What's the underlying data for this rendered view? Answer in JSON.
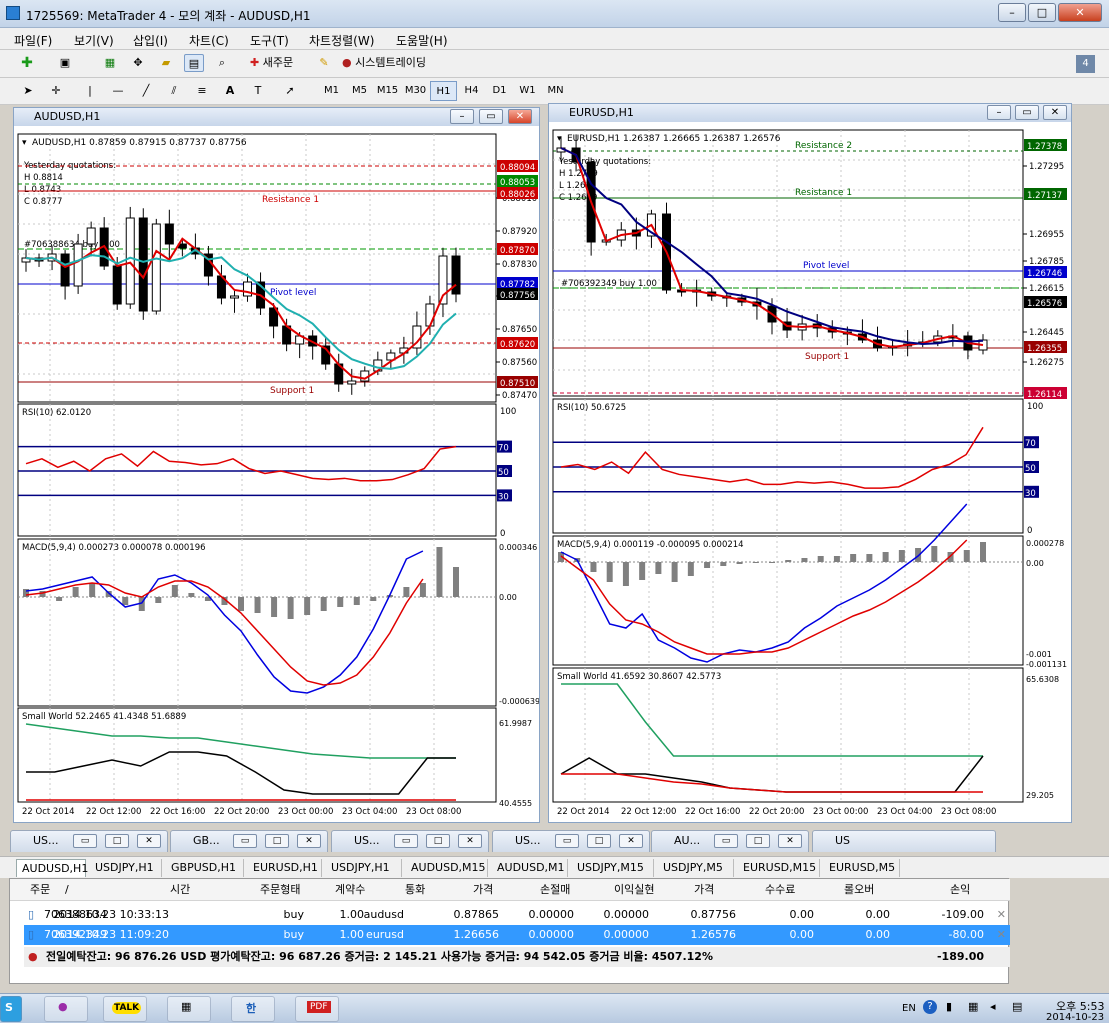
{
  "window": {
    "title": "1725569: MetaTrader 4 - 모의 계좌 - AUDUSD,H1"
  },
  "menu": [
    "파일(F)",
    "보기(V)",
    "삽입(I)",
    "차트(C)",
    "도구(T)",
    "차트정렬(W)",
    "도움말(H)"
  ],
  "toolbar": {
    "new_order": "새주문",
    "auto_trading": "시스템트레이딩",
    "badge": "4"
  },
  "drawing_tools": {
    "text_tool": "A"
  },
  "timeframes": [
    "M1",
    "M5",
    "M15",
    "M30",
    "H1",
    "H4",
    "D1",
    "W1",
    "MN"
  ],
  "active_timeframe": "H1",
  "charts": [
    {
      "window_title": "AUDUSD,H1",
      "header": "AUDUSD,H1  0.87859 0.87915 0.87737 0.87756",
      "quotations": {
        "label": "Yesterday quotations:",
        "h": "H 0.8814",
        "l": "L 0.8743",
        "c": "C 0.8777"
      },
      "order_label": "#706388634 buy 1.00",
      "levels": [
        {
          "name": "Resistance 1",
          "price": "0.88026",
          "color": "#cc0000"
        },
        {
          "name": "Pivot level",
          "price": "0.87782",
          "color": "#0000cc"
        },
        {
          "name": "Support 1",
          "price": "0.87510",
          "color": "#990000"
        }
      ],
      "price_labels": [
        {
          "text": "0.88094",
          "bg": "#cc0000"
        },
        {
          "text": "0.88053",
          "bg": "#008800"
        },
        {
          "text": "0.88026",
          "bg": "#cc0000"
        },
        {
          "text": "0.87870",
          "bg": "#cc0000"
        },
        {
          "text": "0.87782",
          "bg": "#0000cc"
        },
        {
          "text": "0.87756",
          "bg": "#000000"
        },
        {
          "text": "0.87620",
          "bg": "#cc0000"
        },
        {
          "text": "0.87510",
          "bg": "#990000"
        }
      ],
      "price_axis": [
        "0.88010",
        "0.87920",
        "0.87830",
        "0.87740",
        "0.87650",
        "0.87560",
        "0.87470"
      ],
      "rsi": {
        "label": "RSI(10) 62.0120",
        "ticks": [
          "100",
          "70",
          "50",
          "30",
          "0"
        ]
      },
      "macd": {
        "label": "MACD(5,9,4) 0.000273 0.000078 0.000196",
        "ticks": [
          "0.000346",
          "0.00",
          "-0.000639"
        ]
      },
      "smallworld": {
        "label": "Small World 52.2465 41.4348 51.6889",
        "ticks": [
          "61.9987",
          "40.4555"
        ]
      },
      "time_axis": [
        "22 Oct 2014",
        "22 Oct 12:00",
        "22 Oct 16:00",
        "22 Oct 20:00",
        "23 Oct 00:00",
        "23 Oct 04:00",
        "23 Oct 08:00"
      ]
    },
    {
      "window_title": "EURUSD,H1",
      "header": "EURUSD,H1  1.26387 1.26665 1.26387 1.26576",
      "quotations": {
        "label": "Yesterday quotations:",
        "h": "H 1.2769",
        "l": "L 1.2618",
        "c": "C 1.2649"
      },
      "order_label": "#706392349 buy 1.00",
      "levels": [
        {
          "name": "Resistance 2",
          "price": "1.27378",
          "color": "#006600"
        },
        {
          "name": "Resistance 1",
          "price": "1.27137",
          "color": "#006600"
        },
        {
          "name": "Pivot level",
          "price": "1.26746",
          "color": "#0000cc"
        },
        {
          "name": "Support 1",
          "price": "1.26355",
          "color": "#990000"
        }
      ],
      "price_labels": [
        {
          "text": "1.27378",
          "bg": "#006600"
        },
        {
          "text": "1.27137",
          "bg": "#006600"
        },
        {
          "text": "1.26746",
          "bg": "#0000cc"
        },
        {
          "text": "1.26576",
          "bg": "#000000"
        },
        {
          "text": "1.26355",
          "bg": "#990000"
        },
        {
          "text": "1.26114",
          "bg": "#cc0033"
        }
      ],
      "price_axis": [
        "1.27295",
        "1.26955",
        "1.26785",
        "1.26615",
        "1.26445",
        "1.26275"
      ],
      "rsi": {
        "label": "RSI(10) 50.6725",
        "ticks": [
          "100",
          "70",
          "50",
          "30",
          "0"
        ]
      },
      "macd": {
        "label": "MACD(5,9,4) 0.000119 -0.000095 0.000214",
        "ticks": [
          "0.000278",
          "0.00",
          "-0.001",
          "-0.001131"
        ]
      },
      "smallworld": {
        "label": "Small World 41.6592 30.8607 42.5773",
        "ticks": [
          "65.6308",
          "29.205"
        ]
      },
      "time_axis": [
        "22 Oct 2014",
        "22 Oct 12:00",
        "22 Oct 16:00",
        "22 Oct 20:00",
        "23 Oct 00:00",
        "23 Oct 04:00",
        "23 Oct 08:00"
      ]
    }
  ],
  "minimized_windows": [
    "US...",
    "GB...",
    "US...",
    "US...",
    "AU...",
    "US"
  ],
  "chart_tabs": [
    "AUDUSD,H1",
    "USDJPY,H1",
    "GBPUSD,H1",
    "EURUSD,H1",
    "USDJPY,H1",
    "AUDUSD,M15",
    "AUDUSD,M1",
    "USDJPY,M15",
    "USDJPY,M5",
    "EURUSD,M15",
    "EURUSD,M5"
  ],
  "terminal": {
    "columns": [
      "주문",
      "/",
      "시간",
      "주문형태",
      "계약수",
      "통화",
      "가격",
      "손절매",
      "이익실현",
      "가격",
      "수수료",
      "롤오버",
      "손익"
    ],
    "rows": [
      {
        "order": "706388634",
        "time": "2014.10.23 10:33:13",
        "type": "buy",
        "size": "1.00",
        "symbol": "audusd",
        "price": "0.87865",
        "sl": "0.00000",
        "tp": "0.00000",
        "current": "0.87756",
        "commission": "0.00",
        "swap": "0.00",
        "profit": "-109.00"
      },
      {
        "order": "706392349",
        "time": "2014.10.23 11:09:20",
        "type": "buy",
        "size": "1.00",
        "symbol": "eurusd",
        "price": "1.26656",
        "sl": "0.00000",
        "tp": "0.00000",
        "current": "1.26576",
        "commission": "0.00",
        "swap": "0.00",
        "profit": "-80.00"
      }
    ],
    "summary": "전일예탁잔고: 96 876.26 USD   평가예탁잔고: 96 687.26   증거금: 2 145.21   사용가능 증거금: 94 542.05   증거금 비율: 4507.12%",
    "total_profit": "-189.00"
  },
  "taskbar": {
    "lang": "EN",
    "time": "오후 5:53",
    "date": "2014-10-23",
    "kakao": "TALK"
  }
}
